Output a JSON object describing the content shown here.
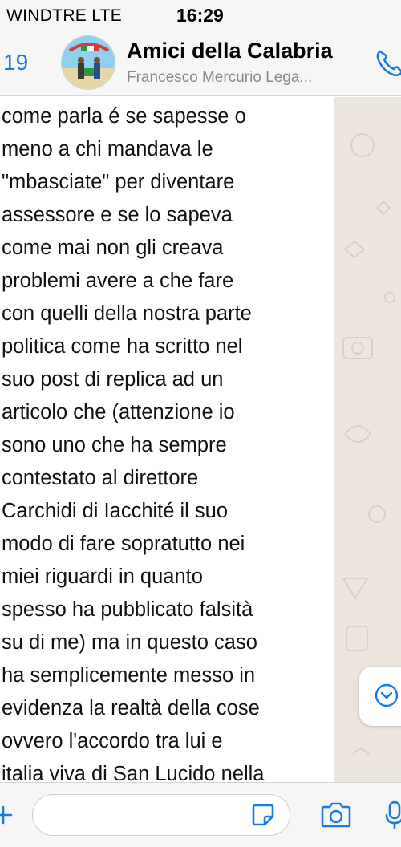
{
  "status_bar": {
    "carrier": "WINDTRE  LTE",
    "time": "16:29"
  },
  "header": {
    "back_count": "19",
    "chat_title": "Amici della Calabria",
    "chat_subtitle": "Francesco Mercurio Lega...",
    "avatar_icon": "group-photo-avatar",
    "call_icon": "phone-icon"
  },
  "message": {
    "text_lines": [
      "come parla é se sapesse o",
      "meno a chi mandava le",
      "\"mbasciate\" per diventare",
      "assessore e se lo sapeva",
      "come mai non gli creava",
      "problemi avere a che fare",
      "con quelli della nostra parte",
      "politica come ha scritto nel",
      "suo post di replica ad un",
      "articolo che (attenzione io",
      "sono uno che ha sempre",
      "contestato al direttore",
      "Carchidi di Iacchité il suo",
      "modo di fare sopratutto nei",
      "miei riguardi in quanto",
      "spesso ha pubblicato falsità",
      "su di me) ma in questo caso",
      "ha semplicemente messo in",
      "evidenza la realtà della cose",
      "ovvero l'accordo tra lui e",
      "italia viva di San Lucido nella"
    ]
  },
  "input_bar": {
    "message_value": "",
    "icons": [
      "plus-icon",
      "sticker-icon",
      "camera-icon",
      "microphone-icon"
    ]
  },
  "colors": {
    "accent": "#1a7ae0",
    "chat_background": "#ece5dd",
    "bar_background": "#f6f6f6",
    "bubble": "#ffffff"
  }
}
